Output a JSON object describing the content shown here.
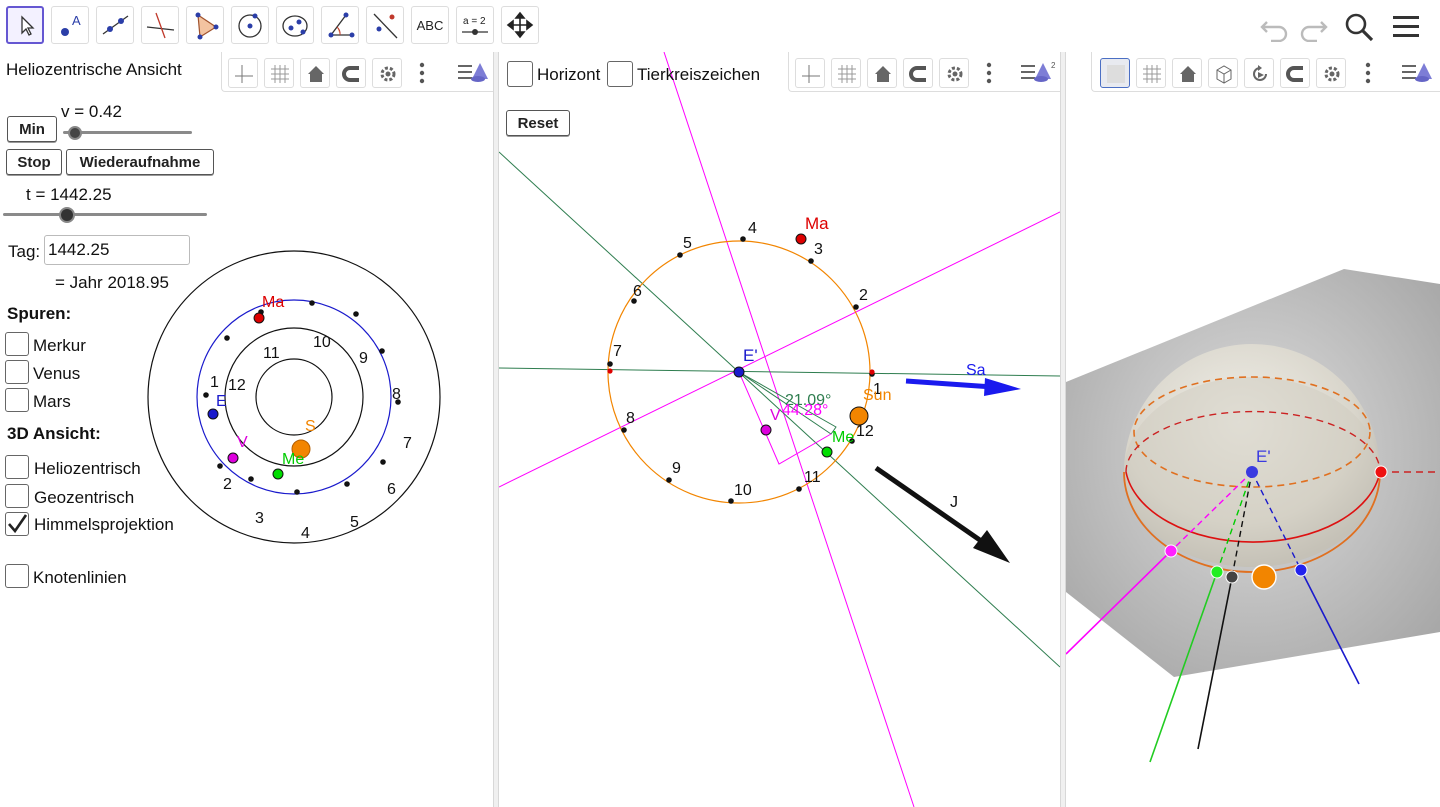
{
  "toolbar": {
    "tools": [
      {
        "name": "move-tool-icon"
      },
      {
        "name": "point-tool-icon",
        "text": "A"
      },
      {
        "name": "line-tool-icon"
      },
      {
        "name": "perpendicular-tool-icon"
      },
      {
        "name": "polygon-tool-icon"
      },
      {
        "name": "circle-tool-icon"
      },
      {
        "name": "ellipse-tool-icon"
      },
      {
        "name": "angle-tool-icon"
      },
      {
        "name": "reflect-tool-icon"
      },
      {
        "name": "text-tool-icon",
        "text": "ABC"
      },
      {
        "name": "slider-tool-icon",
        "text": "a = 2"
      },
      {
        "name": "move-graphics-tool-icon"
      }
    ]
  },
  "left_panel": {
    "title": "Heliozentrische Ansicht",
    "min_label": "Min",
    "v_label": "v = 0.42",
    "v_fraction": 0.04,
    "stop_label": "Stop",
    "resume_label": "Wiederaufnahme",
    "t_label": "t = 1442.25",
    "t_fraction": 0.3,
    "tag_label": "Tag:",
    "tag_value": "1442.25",
    "year_label": "= Jahr 2018.95",
    "tracks_heading": "Spuren:",
    "tracks": [
      "Merkur",
      "Venus",
      "Mars"
    ],
    "view3d_heading": "3D Ansicht:",
    "view3d_options": [
      {
        "label": "Heliozentrisch",
        "checked": false
      },
      {
        "label": "Geozentrisch",
        "checked": false
      },
      {
        "label": "Himmelsprojektion",
        "checked": true
      }
    ],
    "knoten_label": "Knotenlinien"
  },
  "helio_diagram": {
    "sun_label": "S",
    "mercury_label": "Me",
    "venus_label": "V",
    "earth_label": "E",
    "mars_label": "Ma",
    "month_labels": [
      "1",
      "2",
      "3",
      "4",
      "5",
      "6",
      "7",
      "8",
      "9",
      "10",
      "11",
      "12"
    ],
    "colors": {
      "sun": "#f28500",
      "mercury": "#00cc00",
      "venus": "#dd00dd",
      "earth": "#0000cc",
      "mars": "#dd0000"
    }
  },
  "middle_panel": {
    "horizont_label": "Horizont",
    "tierkreis_label": "Tierkreiszeichen",
    "reset_label": "Reset",
    "earth_label": "E'",
    "sun_label": "Sun",
    "mars_label": "Ma",
    "mercury_label": "Me",
    "venus_label": "V",
    "saturn_label": "Sa",
    "jupiter_label": "J",
    "angle1": "21.09°",
    "angle2": "44.28°",
    "ring_labels": [
      "1",
      "2",
      "3",
      "4",
      "5",
      "6",
      "7",
      "8",
      "9",
      "10",
      "11",
      "12"
    ]
  },
  "right_panel": {
    "earth_label": "E'"
  }
}
